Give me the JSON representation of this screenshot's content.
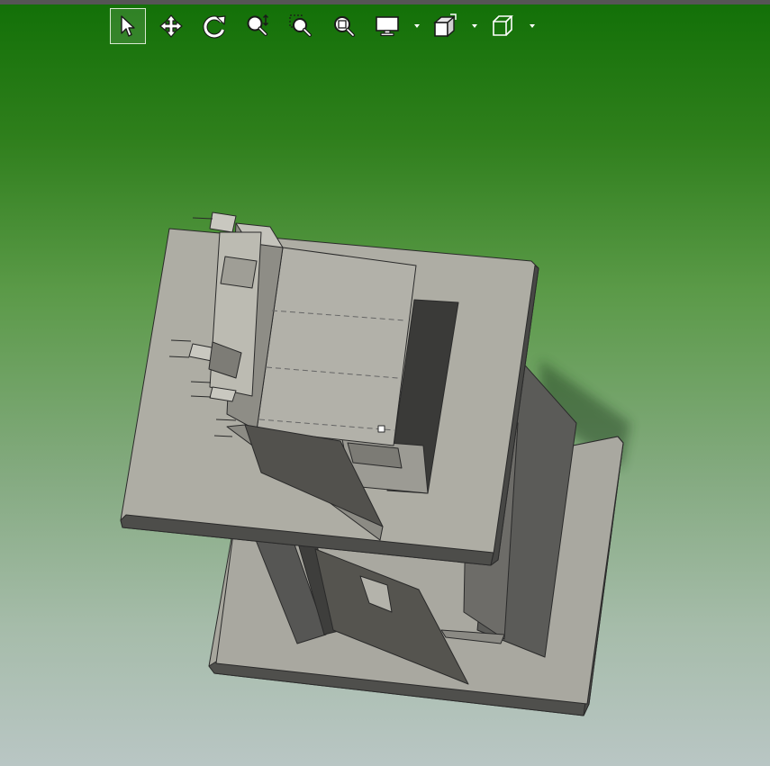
{
  "app": {
    "background_top": "#127007",
    "background_bottom": "#b9c6c4"
  },
  "toolbar": {
    "tools": [
      {
        "icon": "select-arrow-icon",
        "active": true
      },
      {
        "icon": "pan-move-icon",
        "active": false
      },
      {
        "icon": "rotate-view-icon",
        "active": false
      },
      {
        "icon": "zoom-in-out-icon",
        "active": false
      },
      {
        "icon": "zoom-to-area-icon",
        "active": false
      },
      {
        "icon": "zoom-to-fit-icon",
        "active": false
      },
      {
        "icon": "display-style-icon",
        "dropdown": true
      },
      {
        "icon": "view-orientation-icon",
        "dropdown": true
      },
      {
        "icon": "standard-views-cube-icon",
        "dropdown": true
      }
    ]
  },
  "model": {
    "part_color": "#aeada4",
    "shadow_color": "#4a4a46",
    "edge_color": "#2a2a2a"
  }
}
